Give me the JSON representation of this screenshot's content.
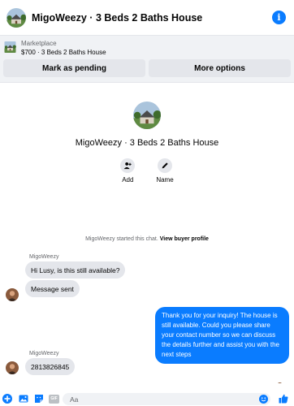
{
  "header": {
    "title": "MigoWeezy · 3 Beds 2 Baths House",
    "info_icon": "info-icon"
  },
  "listing": {
    "label": "Marketplace",
    "summary": "$700 · 3 Beds 2 Baths House",
    "buttons": [
      "Mark as pending",
      "More options"
    ]
  },
  "profile": {
    "name": "MigoWeezy · 3 Beds 2 Baths House",
    "actions": [
      {
        "label": "Add",
        "icon": "add-person-icon"
      },
      {
        "label": "Name",
        "icon": "pencil-icon"
      }
    ]
  },
  "chat": {
    "system_prefix": "MigoWeezy started this chat.",
    "system_link": "View buyer profile",
    "messages": [
      {
        "sender": "MigoWeezy",
        "text": "Hi Lusy, is this still available?"
      },
      {
        "text": "Message sent"
      },
      {
        "text": "Thank you for your inquiry! The house is still available. Could you please share your contact number so we can discuss the details further and assist you with the next steps"
      },
      {
        "sender": "MigoWeezy",
        "text": "2813826845"
      }
    ]
  },
  "composer": {
    "placeholder": "Aa",
    "icons": [
      "plus-icon",
      "photo-icon",
      "sticker-icon",
      "gif-icon",
      "emoji-icon",
      "thumbs-up-icon"
    ],
    "gif_label": "GIF"
  },
  "colors": {
    "accent": "#0a7cff",
    "bubble_in": "#e4e6eb",
    "listing_bg": "#f0f2f5"
  }
}
